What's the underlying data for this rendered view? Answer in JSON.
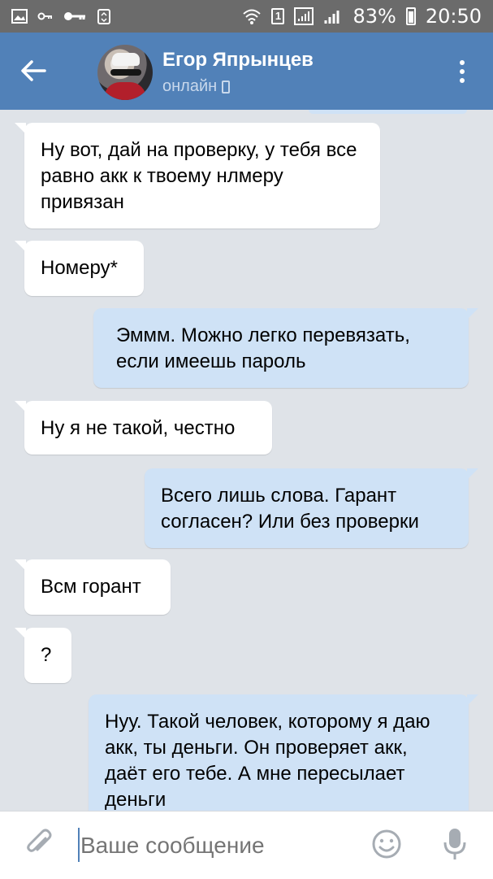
{
  "status_bar": {
    "left_icons": [
      "image-icon",
      "key-small-icon",
      "key-icon",
      "recycle-icon"
    ],
    "sim_label": "1",
    "battery_percent": "83%",
    "time": "20:50"
  },
  "header": {
    "contact_name": "Егор Япрынцев",
    "contact_status": "онлайн",
    "accent_color": "#5181b8"
  },
  "messages": [
    {
      "direction": "in",
      "text": "Ну вот, дай на проверку, у тебя все равно акк к твоему нлмеру привязан"
    },
    {
      "direction": "in",
      "text": "Номеру*"
    },
    {
      "direction": "out",
      "text": "Эммм. Можно легко перевязать, если имеешь пароль"
    },
    {
      "direction": "in",
      "text": "Ну я не такой, честно"
    },
    {
      "direction": "out",
      "text": "Всего лишь слова. Гарант согласен? Или без проверки"
    },
    {
      "direction": "in",
      "text": "Всм горант"
    },
    {
      "direction": "in",
      "text": "?"
    },
    {
      "direction": "out",
      "text": "Нуу. Такой человек, которому я даю акк, ты деньги. Он проверяет акк, даёт его тебе. А мне пересылает деньги"
    }
  ],
  "composer": {
    "placeholder": "Ваше сообщение"
  }
}
